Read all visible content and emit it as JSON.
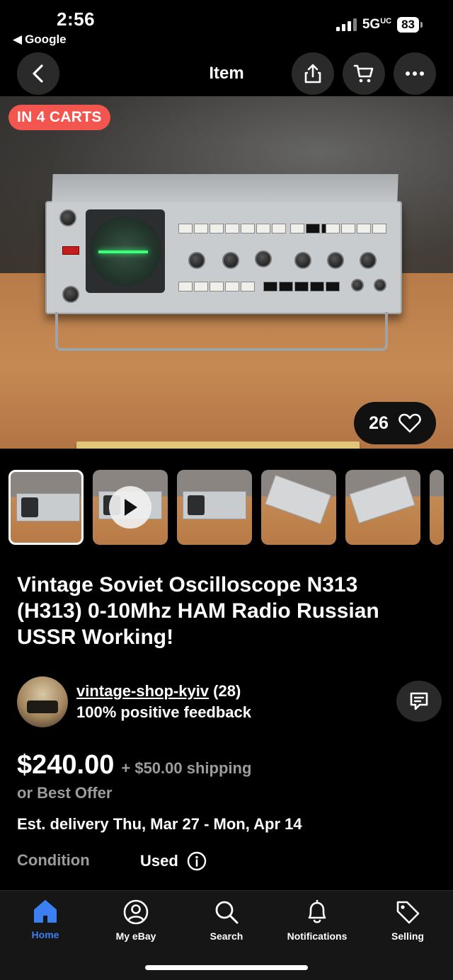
{
  "status": {
    "time": "2:56",
    "back_app": "Google",
    "network": "5G",
    "battery": "83"
  },
  "nav": {
    "title": "Item"
  },
  "hero": {
    "carts_badge": "IN 4 CARTS",
    "likes": "26"
  },
  "thumbnails": [
    {
      "kind": "image"
    },
    {
      "kind": "video"
    },
    {
      "kind": "image"
    },
    {
      "kind": "image"
    },
    {
      "kind": "image"
    }
  ],
  "listing": {
    "title": "Vintage Soviet Oscilloscope N313 (H313) 0-10Mhz HAM Radio Russian USSR Working!",
    "seller": {
      "name": "vintage-shop-kyiv",
      "count": "(28)",
      "feedback": "100% positive feedback"
    },
    "price": "$240.00",
    "shipping": "+ $50.00 shipping",
    "best_offer": "or Best Offer",
    "delivery": "Est. delivery Thu, Mar 27 - Mon, Apr 14",
    "condition_label": "Condition",
    "condition_value": "Used"
  },
  "tabs": [
    {
      "label": "Home",
      "icon": "home-icon",
      "active": true
    },
    {
      "label": "My eBay",
      "icon": "user-icon",
      "active": false
    },
    {
      "label": "Search",
      "icon": "search-icon",
      "active": false
    },
    {
      "label": "Notifications",
      "icon": "bell-icon",
      "active": false
    },
    {
      "label": "Selling",
      "icon": "tag-icon",
      "active": false
    }
  ],
  "colors": {
    "accent": "#3c7ff0",
    "badge": "#f3554f",
    "muted": "#9c9c9c"
  }
}
